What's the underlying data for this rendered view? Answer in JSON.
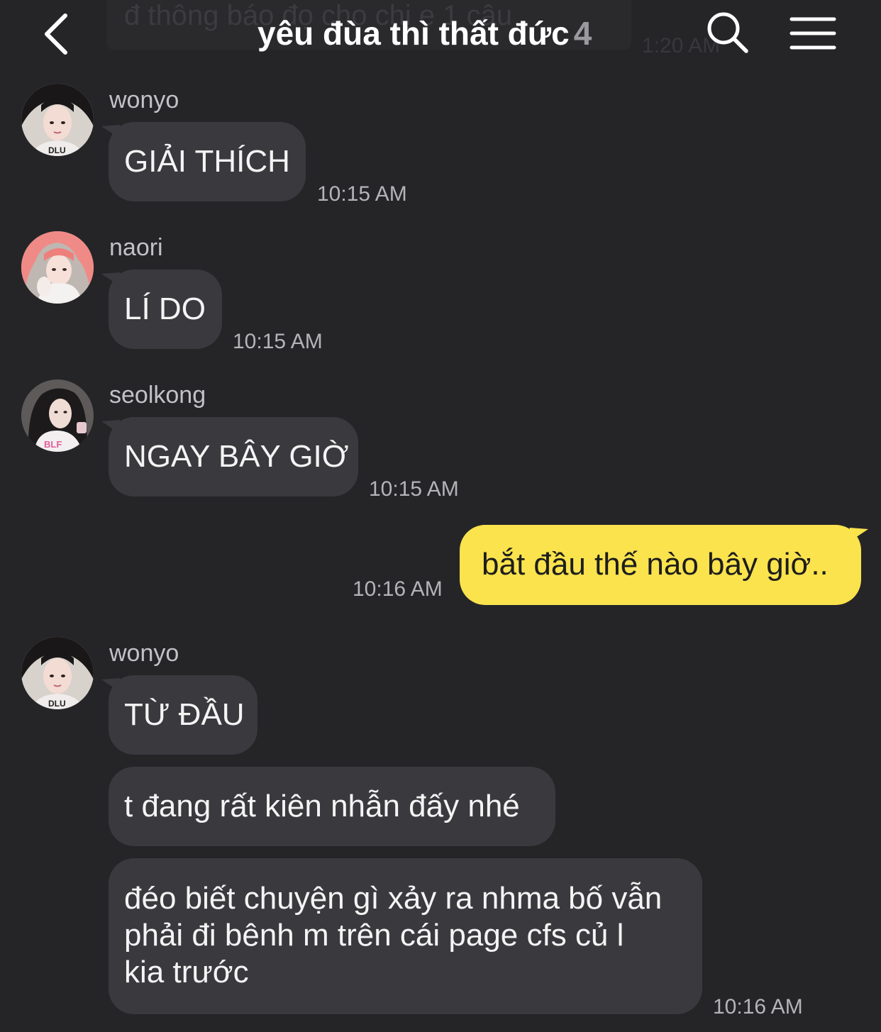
{
  "header": {
    "title": "yêu đùa thì thất đức",
    "member_count": "4",
    "pinned_notice_text": "đ thông báo đọ cho chị e 1 câu",
    "pinned_notice_time": "1:20 AM",
    "back_icon": "chevron-left-icon",
    "search_icon": "search-icon",
    "menu_icon": "hamburger-menu-icon"
  },
  "colors": {
    "background": "#252528",
    "incoming_bubble": "#3a3a3e",
    "outgoing_bubble": "#fae34d",
    "timestamp": "#b4b4b8"
  },
  "messages": [
    {
      "direction": "incoming",
      "sender": "wonyo",
      "text": "GIẢI THÍCH",
      "time": "10:15 AM"
    },
    {
      "direction": "incoming",
      "sender": "naori",
      "text": "LÍ DO",
      "time": "10:15 AM"
    },
    {
      "direction": "incoming",
      "sender": "seolkong",
      "text": "NGAY BÂY GIỜ",
      "time": "10:15 AM"
    },
    {
      "direction": "outgoing",
      "text": "bắt đầu thế nào bây giờ..",
      "time": "10:16 AM"
    },
    {
      "direction": "incoming",
      "sender": "wonyo",
      "text": "TỪ ĐẦU"
    },
    {
      "direction": "incoming",
      "sender": "wonyo",
      "text": "t đang rất kiên nhẫn đấy nhé"
    },
    {
      "direction": "incoming",
      "sender": "wonyo",
      "lines": [
        "đéo biết chuyện gì xảy ra nhma bố vẫn",
        "phải đi bênh m trên cái page cfs củ l",
        "kia trước"
      ],
      "time": "10:16 AM"
    }
  ]
}
